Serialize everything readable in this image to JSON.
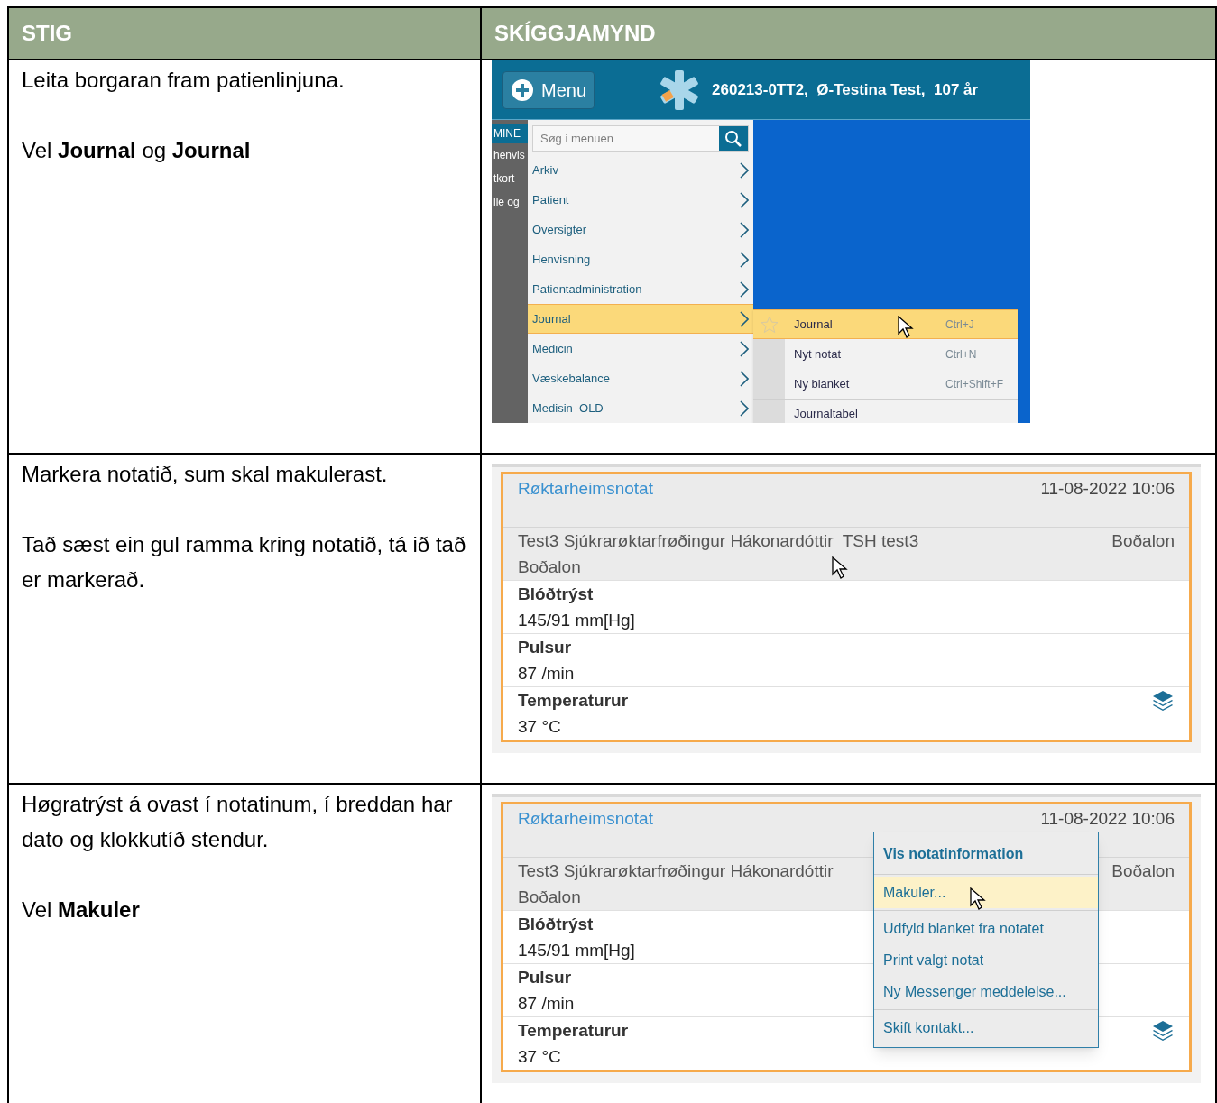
{
  "table": {
    "columns": [
      "STIG",
      "SKÍGGJAMYND"
    ],
    "rows": [
      {
        "step": [
          "Leita borgaran fram patienlinjuna.",
          "Vel **Journal** og **Journal**"
        ],
        "screenshot": {
          "kind": "menu",
          "menu_button": "Menu",
          "patient": "260213-0TT2,  Ø-Testina Test,  107 år",
          "side_texts": [
            "MINE",
            "henvis",
            "tkort",
            "lle og"
          ],
          "search": {
            "placeholder": "Søg i menuen"
          },
          "items": [
            {
              "label": "Arkiv",
              "selected": false
            },
            {
              "label": "Patient",
              "selected": false
            },
            {
              "label": "Oversigter",
              "selected": false
            },
            {
              "label": "Henvisning",
              "selected": false
            },
            {
              "label": "Patientadministration",
              "selected": false
            },
            {
              "label": "Journal",
              "selected": true
            },
            {
              "label": "Medicin",
              "selected": false
            },
            {
              "label": "Væskebalance",
              "selected": false
            },
            {
              "label": "Medisin  OLD",
              "selected": false
            }
          ],
          "submenu": [
            {
              "label": "Journal",
              "shortcut": "Ctrl+J",
              "selected": true
            },
            {
              "label": "Nyt notat",
              "shortcut": "Ctrl+N",
              "selected": false
            },
            {
              "label": "Ny blanket",
              "shortcut": "Ctrl+Shift+F",
              "selected": false
            },
            {
              "label": "Journaltabel",
              "selected": false
            }
          ]
        }
      },
      {
        "step": [
          "Markera notatið, sum skal makulerast.",
          "Tað sæst ein gul ramma kring notatið, tá ið tað er markerað."
        ],
        "screenshot": {
          "kind": "note",
          "selected": true,
          "title": "Røktarheimsnotat",
          "datetime": "11-08-2022 10:06",
          "author": "Test3 Sjúkrarøktarfrøðingur Hákonardóttir  TSH test3",
          "department": "Boðalon",
          "unit": "Boðalon",
          "measurements": [
            {
              "label": "Blóðtrýst",
              "value": "145/91 mm[Hg]"
            },
            {
              "label": "Pulsur",
              "value": "87 /min"
            },
            {
              "label": "Temperaturur",
              "value": "37 °C"
            }
          ]
        }
      },
      {
        "step": [
          "Høgratrýst á ovast í notatinum, í breddan har dato og klokkutíð stendur.",
          "Vel **Makuler**"
        ],
        "screenshot": {
          "kind": "note",
          "selected": true,
          "title": "Røktarheimsnotat",
          "datetime": "11-08-2022 10:06",
          "author": "Test3 Sjúkrarøktarfrøðingur Hákonardóttir",
          "department": "Boðalon",
          "unit": "Boðalon",
          "measurements": [
            {
              "label": "Blóðtrýst",
              "value": "145/91 mm[Hg]"
            },
            {
              "label": "Pulsur",
              "value": "87 /min"
            },
            {
              "label": "Temperaturur",
              "value": "37 °C"
            }
          ],
          "context_menu": [
            [
              {
                "label": "Vis notatinformation",
                "kind": "heading",
                "selected": false
              }
            ],
            [
              {
                "label": "Makuler...",
                "kind": "item",
                "selected": true
              }
            ],
            [
              {
                "label": "Udfyld blanket fra notatet",
                "kind": "item",
                "selected": false
              },
              {
                "label": "Print valgt notat",
                "kind": "item",
                "selected": false
              },
              {
                "label": "Ny Messenger meddelelse...",
                "kind": "item",
                "selected": false
              }
            ],
            [
              {
                "label": "Skift kontakt...",
                "kind": "item",
                "selected": false
              }
            ]
          ]
        }
      }
    ]
  }
}
